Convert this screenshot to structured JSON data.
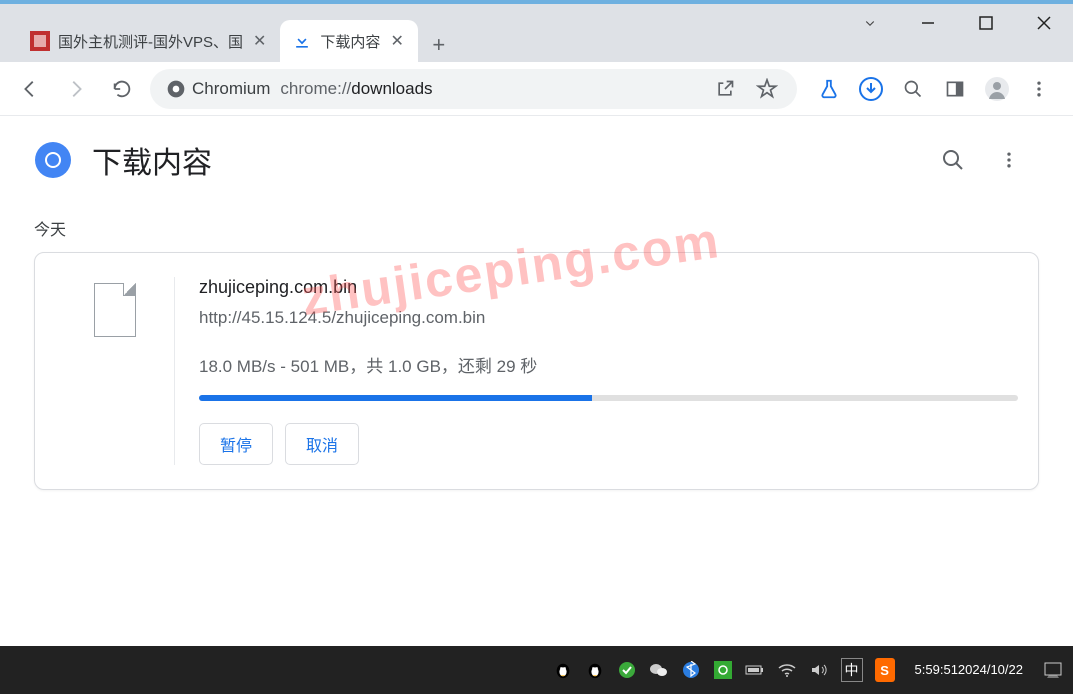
{
  "window": {
    "tabs": [
      {
        "title": "国外主机测评-国外VPS、国",
        "favicon_color": "#c03030"
      },
      {
        "title": "下载内容",
        "favicon": "download-icon"
      }
    ],
    "active_tab": 1
  },
  "addressbar": {
    "chip_label": "Chromium",
    "url_prefix": "chrome://",
    "url_path": "downloads"
  },
  "page": {
    "title": "下载内容",
    "section_today": "今天"
  },
  "download": {
    "filename": "zhujiceping.com.bin",
    "url": "http://45.15.124.5/zhujiceping.com.bin",
    "speed": "18.0 MB/s",
    "done": "501 MB",
    "total": "1.0 GB",
    "remaining": "29 秒",
    "progress_percent": 48,
    "pause_label": "暂停",
    "cancel_label": "取消",
    "status_separator": " - ",
    "status_total_prefix": "，共 ",
    "status_remaining_prefix": "，还剩 "
  },
  "watermark": "zhujiceping.com",
  "taskbar": {
    "ime": "中",
    "time": "5:59:51",
    "date": "2024/10/22"
  }
}
